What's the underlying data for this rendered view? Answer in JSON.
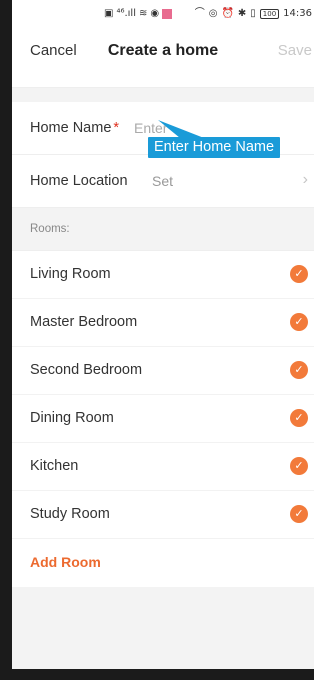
{
  "status_bar": {
    "left_icons": [
      "sim-icon",
      "signal-icon",
      "wifi-icon",
      "app-icon",
      "notification-icon"
    ],
    "right_icons": [
      "headset-icon",
      "eye-icon",
      "alarm-icon",
      "bluetooth-icon",
      "vibrate-icon"
    ],
    "battery": "100",
    "time": "14:36"
  },
  "header": {
    "cancel_label": "Cancel",
    "title": "Create a home",
    "save_label": "Save"
  },
  "form": {
    "home_name_label": "Home Name",
    "required_mark": "*",
    "home_name_placeholder": "Enter",
    "home_name_value": "",
    "home_location_label": "Home Location",
    "home_location_value": "Set"
  },
  "tooltip": {
    "text": "Enter Home Name"
  },
  "rooms": {
    "header": "Rooms:",
    "items": [
      {
        "label": "Living Room",
        "checked": true
      },
      {
        "label": "Master Bedroom",
        "checked": true
      },
      {
        "label": "Second Bedroom",
        "checked": true
      },
      {
        "label": "Dining Room",
        "checked": true
      },
      {
        "label": "Kitchen",
        "checked": true
      },
      {
        "label": "Study Room",
        "checked": true
      }
    ],
    "add_label": "Add Room"
  },
  "colors": {
    "accent": "#ec6a2f",
    "check": "#f27a3a",
    "tooltip": "#1a9bd8",
    "required": "#e0301e"
  }
}
